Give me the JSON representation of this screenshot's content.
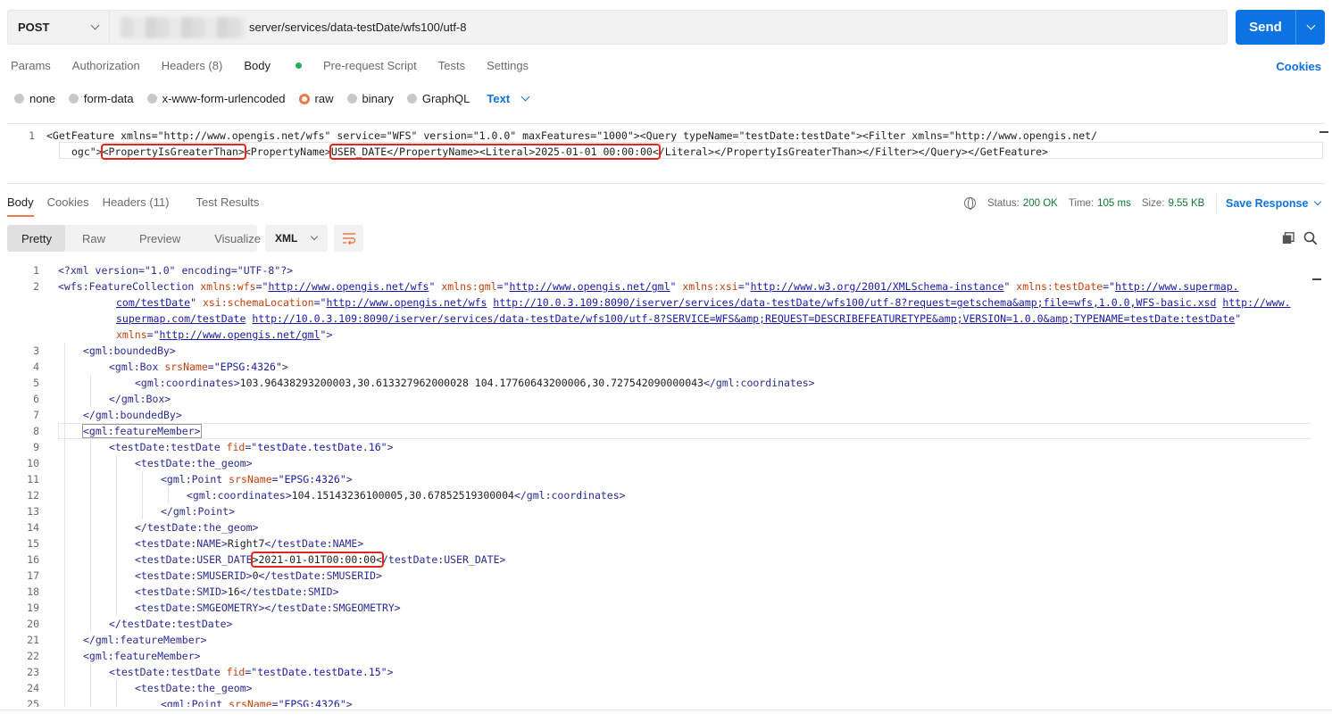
{
  "request": {
    "method": "POST",
    "url_visible": "server/services/data-testDate/wfs100/utf-8",
    "send_label": "Send"
  },
  "req_tabs": {
    "params": "Params",
    "authorization": "Authorization",
    "headers": "Headers (8)",
    "body": "Body",
    "prerequest": "Pre-request Script",
    "tests": "Tests",
    "settings": "Settings",
    "cookies": "Cookies"
  },
  "body_types": {
    "none": "none",
    "form_data": "form-data",
    "urlencoded": "x-www-form-urlencoded",
    "raw": "raw",
    "binary": "binary",
    "graphql": "GraphQL",
    "language": "Text"
  },
  "request_body": {
    "line_number": "1",
    "line1": "<GetFeature xmlns=\"http://www.opengis.net/wfs\" service=\"WFS\" version=\"1.0.0\" maxFeatures=\"1000\"><Query typeName=\"testDate:testDate\"><Filter xmlns=\"http://www.opengis.net/",
    "line2_prefix": "ogc\">",
    "line2_hl1": "<PropertyIsGreaterThan>",
    "line2_mid": "<PropertyName>",
    "line2_hl2": "USER_DATE</PropertyName><Literal>2025-01-01 00:00:00<",
    "line2_suffix": "/Literal></PropertyIsGreaterThan></Filter></Query></GetFeature>"
  },
  "res_tabs": {
    "body": "Body",
    "cookies": "Cookies",
    "headers": "Headers (11)",
    "test_results": "Test Results"
  },
  "res_status": {
    "status_label": "Status:",
    "status_value": "200 OK",
    "time_label": "Time:",
    "time_value": "105 ms",
    "size_label": "Size:",
    "size_value": "9.55 KB",
    "save_response": "Save Response"
  },
  "res_view": {
    "pretty": "Pretty",
    "raw": "Raw",
    "preview": "Preview",
    "visualize": "Visualize",
    "format": "XML"
  },
  "response": {
    "l1": "<?xml version=\"1.0\" encoding=\"UTF-8\"?>",
    "l2a_tag": "<wfs:FeatureCollection ",
    "l2a_a1": "xmlns:wfs",
    "l2a_u1": "http://www.opengis.net/wfs",
    "l2a_a2": "xmlns:gml",
    "l2a_u2": "http://www.opengis.net/gml",
    "l2a_a3": "xmlns:xsi",
    "l2a_u3": "http://www.w3.org/2001/XMLSchema-instance",
    "l2a_a4": "xmlns:testDate",
    "l2a_u4": "http://www.supermap.",
    "l2b_u4": "com/testDate",
    "l2b_a5": "xsi:schemaLocation",
    "l2b_u5": "http://www.opengis.net/wfs",
    "l2b_u6": "http://10.0.3.109:8090/iserver/services/data-testDate/wfs100/utf-8?request=getschema&amp;file=wfs,1.0.0,WFS-basic.xsd",
    "l2b_u7": "http://www.",
    "l2c_u7": "supermap.com/testDate",
    "l2c_u8": "http://10.0.3.109:8090/iserver/services/data-testDate/wfs100/utf-8?SERVICE=WFS&amp;REQUEST=DESCRIBEFEATURETYPE&amp;VERSION=1.0.0&amp;TYPENAME=testDate:testDate",
    "l2d_a": "xmlns",
    "l2d_u": "http://www.opengis.net/gml",
    "l3": "<gml:boundedBy>",
    "l4_tag": "<gml:Box ",
    "l4_attr": "srsName",
    "l4_val": "\"EPSG:4326\"",
    "l5_open": "<gml:coordinates>",
    "l5_text": "103.96438293200003,30.613327962000028 104.17760643200006,30.727542090000043",
    "l5_close": "</gml:coordinates>",
    "l6": "</gml:Box>",
    "l7": "</gml:boundedBy>",
    "l8": "<gml:featureMember>",
    "l9_tag": "<testDate:testDate ",
    "l9_attr": "fid",
    "l9_val": "\"testDate.testDate.16\"",
    "l10": "<testDate:the_geom>",
    "l11_tag": "<gml:Point ",
    "l11_attr": "srsName",
    "l11_val": "\"EPSG:4326\"",
    "l12_open": "<gml:coordinates>",
    "l12_text": "104.15143236100005,30.67852519300004",
    "l12_close": "</gml:coordinates>",
    "l13": "</gml:Point>",
    "l14": "</testDate:the_geom>",
    "l15_open": "<testDate:NAME>",
    "l15_text": "Right7",
    "l15_close": "</testDate:NAME>",
    "l16_open": "<testDate:USER_DATE",
    "l16_hl": ">2021-01-01T00:00:00<",
    "l16_close": "/testDate:USER_DATE>",
    "l17_open": "<testDate:SMUSERID>",
    "l17_text": "0",
    "l17_close": "</testDate:SMUSERID>",
    "l18_open": "<testDate:SMID>",
    "l18_text": "16",
    "l18_close": "</testDate:SMID>",
    "l19": "<testDate:SMGEOMETRY></testDate:SMGEOMETRY>",
    "l20": "</testDate:testDate>",
    "l21": "</gml:featureMember>",
    "l22": "<gml:featureMember>",
    "l23_tag": "<testDate:testDate ",
    "l23_attr": "fid",
    "l23_val": "\"testDate.testDate.15\"",
    "l24": "<testDate:the_geom>",
    "l25_tag": "<gml:Point ",
    "l25_attr": "srsName",
    "l25_val": "\"EPSG:4326\""
  },
  "colors": {
    "accent": "#0e73e2",
    "highlight_box": "#e3251c",
    "raw_radio": "#ea7a4c",
    "status_green": "#0c7a2c"
  }
}
